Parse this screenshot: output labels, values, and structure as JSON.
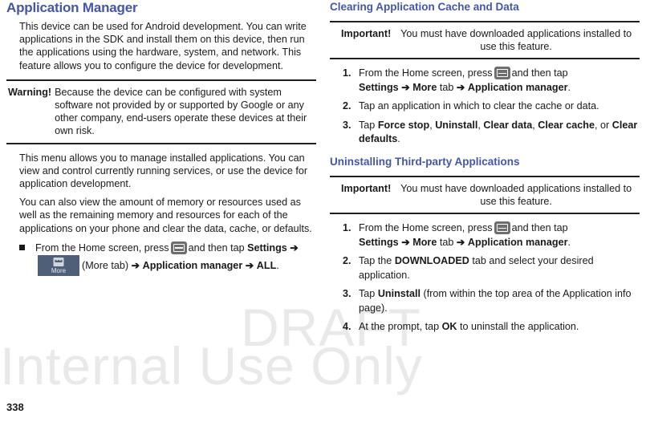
{
  "document": {
    "page_number": "338",
    "heading_color": "#4456a6",
    "watermark": {
      "line1": "DRAFT",
      "line2": "Internal Use Only",
      "color": "#e9e9e9"
    }
  },
  "icons": {
    "menu_key": "menu-key-icon",
    "more_tab": {
      "name": "more-tab-icon",
      "label": "More"
    }
  },
  "left_column": {
    "title": "Application Manager",
    "intro_paragraph": "This device can be used for Android development. You can write applications in the SDK and install them on this device, then run the applications using the hardware, system, and network. This feature allows you to configure the device for development.",
    "warning": {
      "label": "Warning!",
      "text": "Because the device can be configured with system software not provided by or supported by Google or any other company, end-users operate these devices at their own risk."
    },
    "paragraph_2": "This menu allows you to manage installed applications. You can view and control currently running services, or use the device for application development.",
    "paragraph_3": "You can also view the amount of memory or resources used as well as the remaining memory and resources for each of the applications on your phone and clear the data, cache, or defaults.",
    "bullet_step": {
      "pre_icon": "From the Home screen, press",
      "post_icon": "and then tap",
      "settings": "Settings",
      "arrow": "➔",
      "more_tab_paren": "(More tab)",
      "application_manager": "Application manager",
      "all": "ALL",
      "period": "."
    }
  },
  "right_column": {
    "section_1": {
      "title": "Clearing Application Cache and Data",
      "important": {
        "label": "Important!",
        "text": "You must have downloaded applications installed to use this feature."
      },
      "steps": [
        {
          "id": "step-1",
          "pre_icon": "From the Home screen, press",
          "post_icon": "and then tap",
          "settings": "Settings",
          "arrow": "➔",
          "more": "More",
          "tab_word": "tab",
          "application_manager": "Application manager",
          "period": "."
        },
        {
          "id": "step-2",
          "text": "Tap an application in which to clear the cache or data."
        },
        {
          "id": "step-3",
          "prefix": "Tap ",
          "bold_items": [
            "Force stop",
            "Uninstall",
            "Clear data",
            "Clear cache"
          ],
          "or_word": ", or ",
          "last_bold": "Clear defaults",
          "period": "."
        }
      ]
    },
    "section_2": {
      "title": "Uninstalling Third-party Applications",
      "important": {
        "label": "Important!",
        "text": "You must have downloaded applications installed to use this feature."
      },
      "steps": [
        {
          "id": "step-1",
          "pre_icon": "From the Home screen, press",
          "post_icon": "and then tap",
          "settings": "Settings",
          "arrow": "➔",
          "more": "More",
          "tab_word": "tab",
          "application_manager": "Application manager",
          "period": "."
        },
        {
          "id": "step-2",
          "prefix": "Tap the ",
          "bold": "DOWNLOADED",
          "suffix": " tab and select your desired application."
        },
        {
          "id": "step-3",
          "prefix": "Tap ",
          "bold": "Uninstall",
          "suffix": " (from within the top area of the Application info page)."
        },
        {
          "id": "step-4",
          "prefix": "At the prompt, tap ",
          "bold": "OK",
          "suffix": " to uninstall the application."
        }
      ]
    }
  }
}
